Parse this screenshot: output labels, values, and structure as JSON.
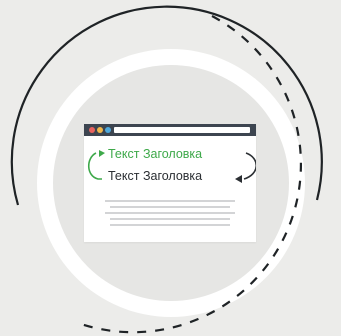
{
  "illustration": {
    "headline_new": "Текст Заголовка",
    "headline_old": "Текст Заголовка",
    "colors": {
      "background": "#ececea",
      "ring": "#ffffff",
      "inner_circle": "#e6e6e4",
      "accent_green": "#3ea94a",
      "dark": "#2b2f33",
      "window_bar": "#3d4550",
      "dot_red": "#e8635f",
      "dot_amber": "#f2b84b",
      "dot_blue": "#4fa9dc"
    },
    "icons": [
      "swap-arrow-left-icon",
      "swap-arrow-right-icon",
      "window-control-dots-icon"
    ]
  }
}
